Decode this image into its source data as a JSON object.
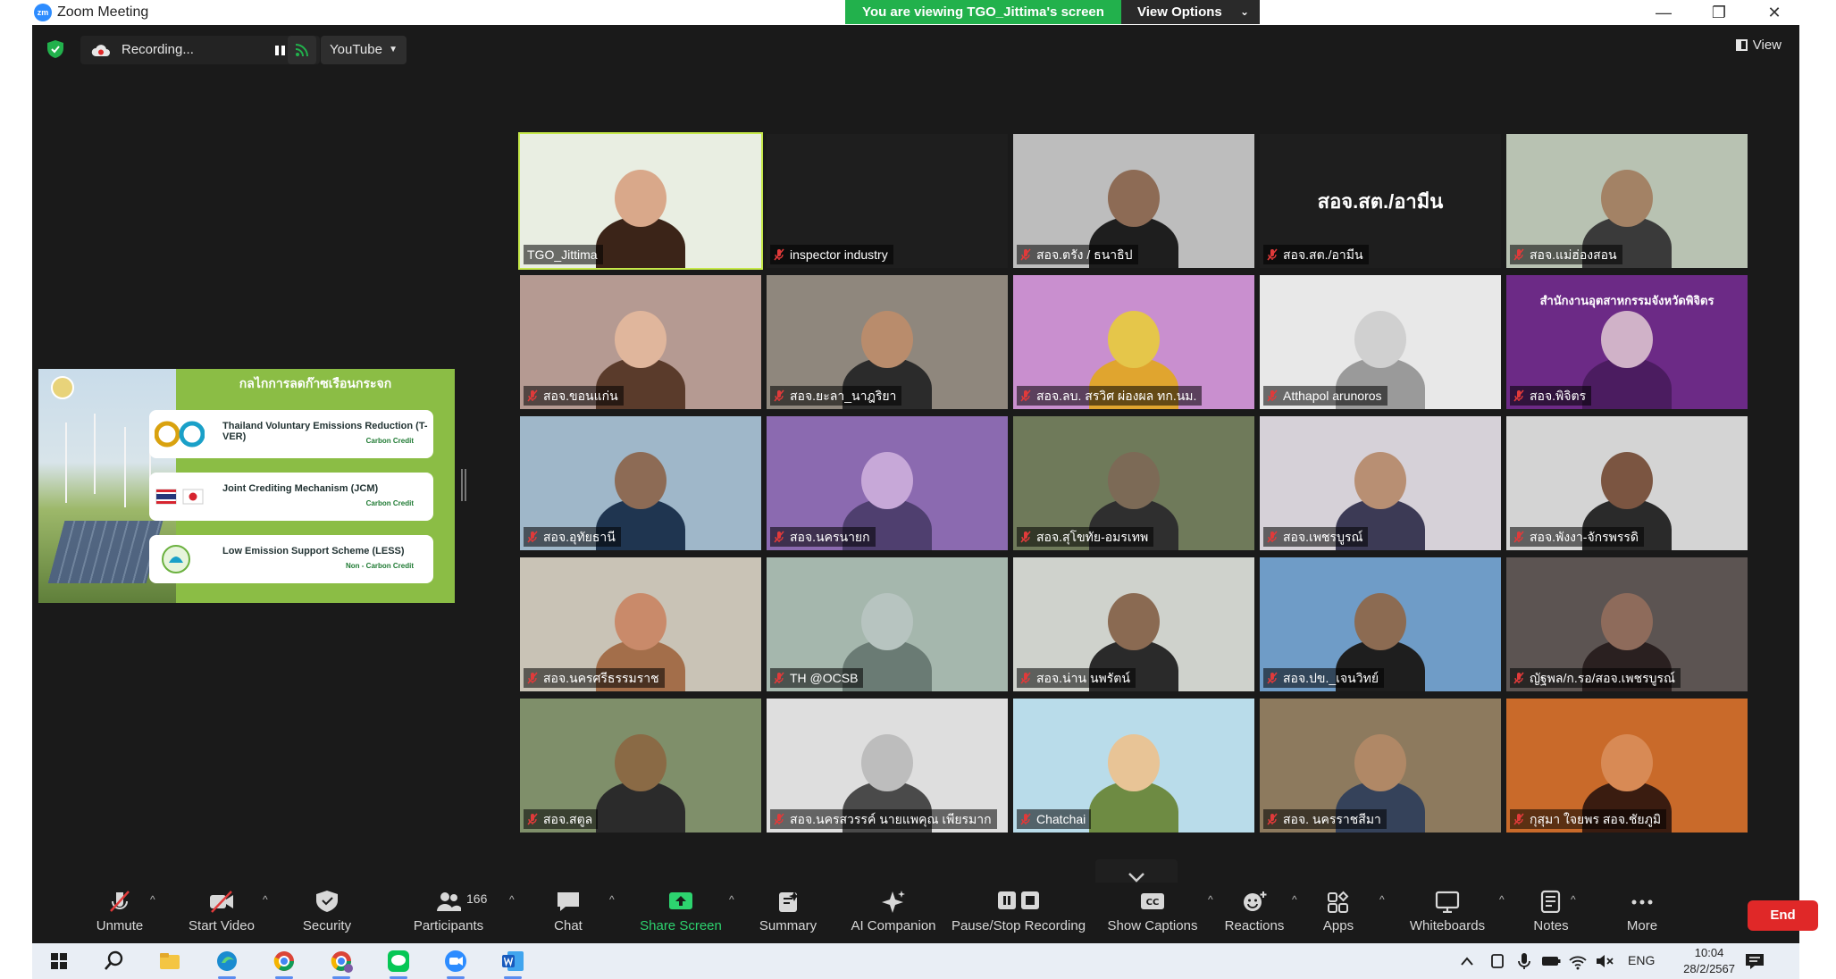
{
  "window": {
    "title": "Zoom Meeting",
    "logo_text": "zm",
    "viewing_banner": "You are viewing TGO_Jittima's screen",
    "view_options": "View Options",
    "minimize": "—",
    "maximize": "❐",
    "close": "✕"
  },
  "top_toolbar": {
    "recording_label": "Recording...",
    "stream_target": "YouTube",
    "view_label": "View"
  },
  "shared_screen": {
    "title": "กลไกการลดก๊าซเรือนกระจก",
    "cards": [
      {
        "name": "Thailand Voluntary Emissions Reduction (T-VER)",
        "sub": "Carbon Credit"
      },
      {
        "name": "Joint Crediting Mechanism (JCM)",
        "sub": "Carbon Credit"
      },
      {
        "name": "Low Emission Support Scheme (LESS)",
        "sub": "Non - Carbon Credit"
      }
    ]
  },
  "participants": [
    {
      "name": "TGO_Jittima",
      "muted": false,
      "active": true,
      "bg": "#e9eee2",
      "fig": "#3b2418",
      "skin": "#d9a88a"
    },
    {
      "name": "inspector industry",
      "muted": true,
      "bg": "#1e1e1e"
    },
    {
      "name": "สอจ.ตรัง / ธนาธิป",
      "muted": true,
      "bg": "#bdbdbd",
      "fig": "#1e1e1e",
      "skin": "#8d6b55"
    },
    {
      "name": "สอจ.สต./อามีน",
      "muted": true,
      "bg": "#1e1e1e",
      "big_text": "สอจ.สต./อามีน"
    },
    {
      "name": "สอจ.แม่ฮ่องสอน",
      "muted": true,
      "bg": "#b8c2b2",
      "fig": "#3a3a3a",
      "skin": "#a38265"
    },
    {
      "name": "สอจ.ขอนแก่น",
      "muted": true,
      "bg": "#b59a92",
      "fig": "#5a3b2b",
      "skin": "#e0b69c"
    },
    {
      "name": "สอจ.ยะลา_นาฎริยา",
      "muted": true,
      "bg": "#8f877d",
      "fig": "#2b2b2b",
      "skin": "#b98c6c"
    },
    {
      "name": "สอจ.ลบ. สรวิศ ผ่องผล ทก.นม.",
      "muted": true,
      "bg": "#c98fcf",
      "fig": "#e0a52f",
      "skin": "#e5c64a"
    },
    {
      "name": "Atthapol arunoros",
      "muted": true,
      "bg": "#e8e8e8",
      "fig": "#9a9a9a",
      "skin": "#d0d0d0"
    },
    {
      "name": "สอจ.พิจิตร",
      "muted": true,
      "bg": "#6c2a86",
      "fig": "#4b1c60",
      "skin": "#d0b2c8",
      "big_text": "สำนักงานอุตสาหกรรมจังหวัดพิจิตร"
    },
    {
      "name": "สอจ.อุทัยธานี",
      "muted": true,
      "bg": "#9fb7c9",
      "fig": "#1f3550",
      "skin": "#8d6b55"
    },
    {
      "name": "สอจ.นครนายก",
      "muted": true,
      "bg": "#8b6ab0",
      "fig": "#4f3f6f",
      "skin": "#c7a8d8"
    },
    {
      "name": "สอจ.สุโขทัย-อมรเทพ",
      "muted": true,
      "bg": "#6f7a5a",
      "fig": "#2f2f2f",
      "skin": "#7c6a56"
    },
    {
      "name": "สอจ.เพชรบูรณ์",
      "muted": true,
      "bg": "#d6d1d8",
      "fig": "#3c3a55",
      "skin": "#b88f73"
    },
    {
      "name": "สอจ.พังงา-จักรพรรดิ",
      "muted": true,
      "bg": "#d4d4d4",
      "fig": "#2a2a2a",
      "skin": "#7b5541"
    },
    {
      "name": "สอจ.นครศรีธรรมราช",
      "muted": true,
      "bg": "#c9c3b6",
      "fig": "#a36e4a",
      "skin": "#c98a6a"
    },
    {
      "name": "TH @OCSB",
      "muted": true,
      "bg": "#a5b7ad",
      "fig": "#6a7b74",
      "skin": "#b7c4c0"
    },
    {
      "name": "สอจ.น่าน นพรัตน์",
      "muted": true,
      "bg": "#cfd2cc",
      "fig": "#2a2a2a",
      "skin": "#8a6a52"
    },
    {
      "name": "สอจ.ปข._เจนวิทย์",
      "muted": true,
      "bg": "#6f9cc7",
      "fig": "#1e1e1e",
      "skin": "#8c6b52"
    },
    {
      "name": "ญัฐพล/ก.รอ/สอจ.เพชรบูรณ์",
      "muted": true,
      "bg": "#5c5452",
      "fig": "#2a2020",
      "skin": "#8e6b5b"
    },
    {
      "name": "สอจ.สตูล",
      "muted": true,
      "bg": "#7f8f6a",
      "fig": "#2b2b2b",
      "skin": "#8a6a45"
    },
    {
      "name": "สอจ.นครสวรรค์ นายแพคุณ เพียรมาก",
      "muted": true,
      "bg": "#dedede",
      "fig": "#4a4a4a",
      "skin": "#bdbdbd"
    },
    {
      "name": "Chatchai",
      "muted": true,
      "bg": "#b9dcea",
      "fig": "#6e8b43",
      "skin": "#e8c496"
    },
    {
      "name": "สอจ. นครราชสีมา",
      "muted": true,
      "bg": "#8d7a5e",
      "fig": "#35425a",
      "skin": "#b08866"
    },
    {
      "name": "กุสุมา ใจยพร สอจ.ชัยภูมิ",
      "muted": true,
      "bg": "#c96a2a",
      "fig": "#3a1c10",
      "skin": "#d88a55"
    }
  ],
  "bottom_toolbar": {
    "items": [
      {
        "key": "unmute",
        "label": "Unmute"
      },
      {
        "key": "start-video",
        "label": "Start Video"
      },
      {
        "key": "security",
        "label": "Security"
      },
      {
        "key": "participants",
        "label": "Participants",
        "count": "166"
      },
      {
        "key": "chat",
        "label": "Chat"
      },
      {
        "key": "share-screen",
        "label": "Share Screen"
      },
      {
        "key": "summary",
        "label": "Summary"
      },
      {
        "key": "ai-companion",
        "label": "AI Companion"
      },
      {
        "key": "pause-stop-recording",
        "label": "Pause/Stop Recording"
      },
      {
        "key": "show-captions",
        "label": "Show Captions"
      },
      {
        "key": "reactions",
        "label": "Reactions"
      },
      {
        "key": "apps",
        "label": "Apps"
      },
      {
        "key": "whiteboards",
        "label": "Whiteboards"
      },
      {
        "key": "notes",
        "label": "Notes"
      },
      {
        "key": "more",
        "label": "More"
      }
    ],
    "end_label": "End"
  },
  "taskbar": {
    "language": "ENG",
    "time": "10:04",
    "date": "28/2/2567"
  },
  "colors": {
    "meeting_bg": "#1a1a1a",
    "banner_green": "#22b14c",
    "end_red": "#e02828",
    "active_speaker": "#c5e84a",
    "share_green": "#2dd36f"
  }
}
